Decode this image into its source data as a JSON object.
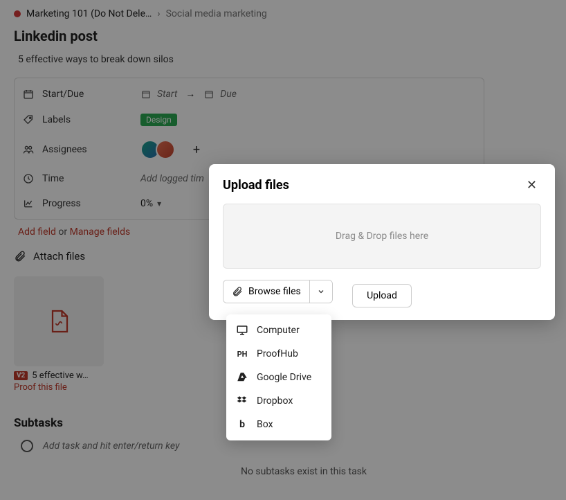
{
  "breadcrumb": {
    "project": "Marketing 101 (Do Not Dele…",
    "section": "Social media marketing"
  },
  "task": {
    "title": "Linkedin post",
    "subtitle": "5 effective ways to break down silos"
  },
  "fields": {
    "startdue_label": "Start/Due",
    "startdue_start": "Start",
    "startdue_due": "Due",
    "labels_label": "Labels",
    "labels_value": "Design",
    "assignees_label": "Assignees",
    "time_label": "Time",
    "time_value": "Add logged tim",
    "progress_label": "Progress",
    "progress_value": "0%"
  },
  "links": {
    "add_field": "Add field",
    "or": "or",
    "manage_fields": "Manage fields"
  },
  "attach": {
    "label": "Attach files",
    "file_badge": "V2",
    "file_name": "5 effective w…",
    "proof": "Proof this file"
  },
  "subtasks": {
    "heading": "Subtasks",
    "placeholder": "Add task and hit enter/return key",
    "empty": "No subtasks exist in this task"
  },
  "modal": {
    "title": "Upload files",
    "dropzone": "Drag & Drop files here",
    "browse": "Browse files",
    "upload": "Upload"
  },
  "menu": {
    "items": [
      {
        "label": "Computer"
      },
      {
        "label": "ProofHub"
      },
      {
        "label": "Google Drive"
      },
      {
        "label": "Dropbox"
      },
      {
        "label": "Box"
      }
    ]
  }
}
